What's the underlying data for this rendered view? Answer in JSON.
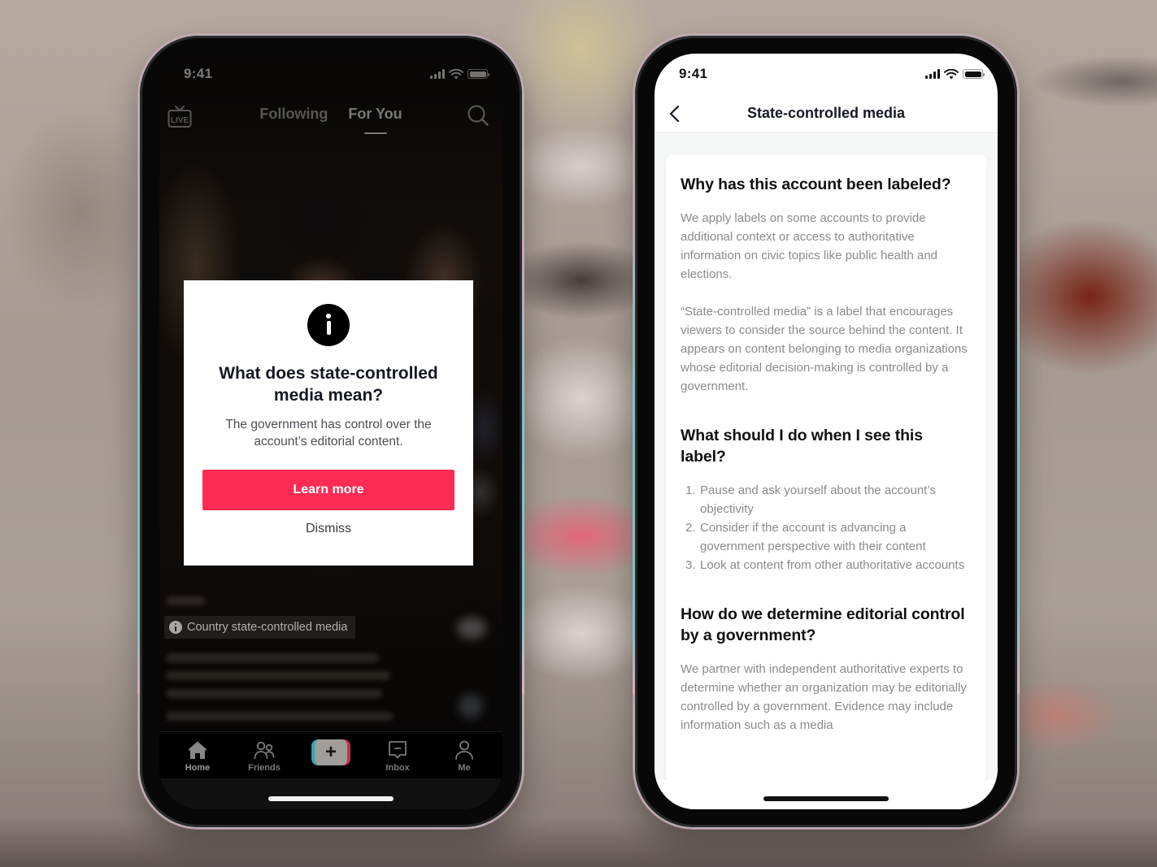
{
  "left_phone": {
    "status_bar": {
      "time": "9:41"
    },
    "top_nav": {
      "live_label": "LIVE",
      "tabs": [
        {
          "label": "Following",
          "active": false
        },
        {
          "label": "For You",
          "active": true
        }
      ]
    },
    "dialog": {
      "title": "What does state-controlled media mean?",
      "body": "The government has control over the account’s editorial content.",
      "primary_button": "Learn more",
      "secondary_button": "Dismiss",
      "primary_color": "#fe2c55"
    },
    "video_label": "Country state-controlled media",
    "bottom_nav": {
      "items": [
        {
          "label": "Home",
          "icon": "home-icon",
          "active": true
        },
        {
          "label": "Friends",
          "icon": "friends-icon",
          "active": false
        },
        {
          "label": "",
          "icon": "plus-icon",
          "active": false
        },
        {
          "label": "Inbox",
          "icon": "inbox-icon",
          "active": false
        },
        {
          "label": "Me",
          "icon": "profile-icon",
          "active": false
        }
      ],
      "create_symbol": "+"
    }
  },
  "right_phone": {
    "status_bar": {
      "time": "9:41"
    },
    "header": {
      "title": "State-controlled media"
    },
    "sections": [
      {
        "heading": "Why has this account been labeled?",
        "paragraphs": [
          "We apply labels on some accounts to provide additional context or access to authoritative information on civic topics like public health and elections.",
          "“State-controlled media” is a label that encourages viewers to consider the source behind the content. It appears on content belonging to media organizations whose editorial decision-making is controlled by a government."
        ]
      },
      {
        "heading": "What should I do when I see this label?",
        "list": [
          {
            "num": "1.",
            "text": "Pause and ask yourself about the account’s objectivity"
          },
          {
            "num": "2.",
            "text": "Consider if the account is advancing a government perspective with their content"
          },
          {
            "num": "3.",
            "text": "Look at content from other authoritative accounts"
          }
        ]
      },
      {
        "heading": "How do we determine editorial control by a government?",
        "paragraphs": [
          "We partner with independent authoritative experts to determine whether an organization may be editorially controlled by a government. Evidence may include information such as a media"
        ]
      }
    ]
  }
}
